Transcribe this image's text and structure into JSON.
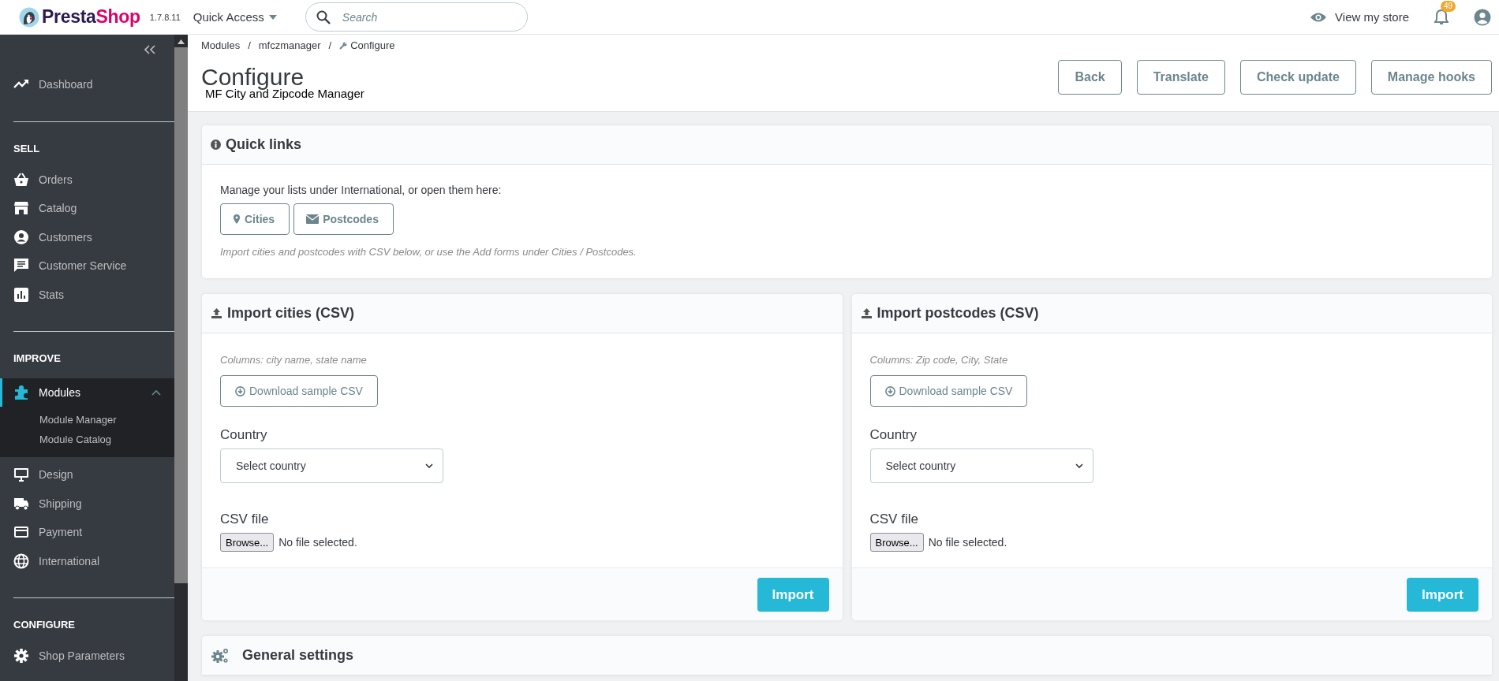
{
  "topbar": {
    "logo_parts": [
      "Presta",
      "Shop"
    ],
    "version": "1.7.8.11",
    "quick_access": "Quick Access",
    "search": {
      "placeholder": "Search"
    },
    "view_store": "View my store",
    "notifications": "49"
  },
  "sidebar": {
    "sections": [
      {
        "items": [
          {
            "label": "Dashboard",
            "selected": false
          }
        ]
      },
      {
        "heading": "SELL",
        "items": [
          {
            "label": "Orders",
            "selected": false
          },
          {
            "label": "Catalog",
            "selected": false
          },
          {
            "label": "Customers",
            "selected": false
          },
          {
            "label": "Customer Service",
            "selected": false
          },
          {
            "label": "Stats",
            "selected": false
          }
        ]
      },
      {
        "heading": "IMPROVE",
        "items": [
          {
            "label": "Modules",
            "selected": true,
            "expanded": true,
            "children": [
              {
                "label": "Module Manager",
                "selected": false
              },
              {
                "label": "Module Catalog",
                "selected": false
              }
            ]
          },
          {
            "label": "Design",
            "selected": false
          },
          {
            "label": "Shipping",
            "selected": false
          },
          {
            "label": "Payment",
            "selected": false
          },
          {
            "label": "International",
            "selected": false
          }
        ]
      },
      {
        "heading": "CONFIGURE",
        "items": [
          {
            "label": "Shop Parameters",
            "selected": false
          }
        ]
      }
    ]
  },
  "breadcrumb": [
    {
      "kind": "link",
      "label": "Modules"
    },
    {
      "kind": "separator",
      "label": "/"
    },
    {
      "kind": "link",
      "label": "mfczmanager"
    },
    {
      "kind": "separator",
      "label": "/"
    },
    {
      "kind": "current",
      "label": "Configure"
    }
  ],
  "page_title": "Configure",
  "page_subtitle": "MF City and Zipcode Manager",
  "toolbar_buttons": [
    "Back",
    "Translate",
    "Check update",
    "Manage hooks"
  ],
  "quick_links": {
    "title": "Quick links",
    "intro": "Manage your lists under International, or open them here:",
    "buttons": [
      "Cities",
      "Postcodes"
    ],
    "note": "Import cities and postcodes with CSV below, or use the Add forms under Cities / Postcodes."
  },
  "import_panels": [
    {
      "title": "Import cities (CSV)",
      "columns_note": "Columns: city name, state name",
      "download_button": "Download sample CSV",
      "country_label": "Country",
      "country_select": "Select country",
      "file_label": "CSV file",
      "browse_button": "Browse...",
      "file_status": "No file selected.",
      "submit_button": "Import"
    },
    {
      "title": "Import postcodes (CSV)",
      "columns_note": "Columns: Zip code, City, State",
      "download_button": "Download sample CSV",
      "country_label": "Country",
      "country_select": "Select country",
      "file_label": "CSV file",
      "browse_button": "Browse...",
      "file_status": "No file selected.",
      "submit_button": "Import"
    }
  ],
  "general_settings": {
    "title": "General settings"
  }
}
